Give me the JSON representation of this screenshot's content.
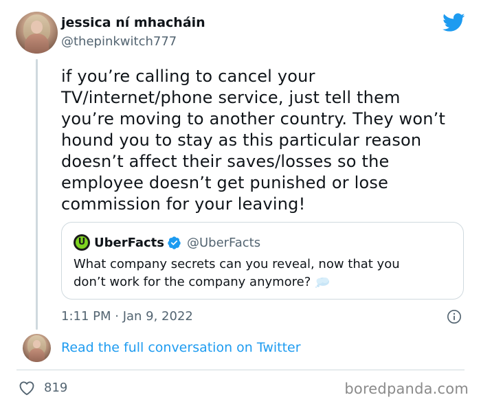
{
  "author": {
    "display_name": "jessica ní mhacháin",
    "handle": "@thepinkwitch777",
    "avatar_icon": "profile-photo"
  },
  "brand": {
    "icon": "twitter-bird-icon",
    "color": "#1d9bf0"
  },
  "tweet": {
    "text_lines": [
      "if you’re calling to cancel your",
      "TV/internet/phone service, just tell them",
      "you’re moving to another country. They won’t",
      "hound you to stay as this particular reason",
      "doesn’t affect their saves/losses so the",
      "employee doesn’t get punished or lose",
      "commission for your leaving!"
    ],
    "timestamp": "1:11 PM · Jan 9, 2022"
  },
  "quoted_tweet": {
    "display_name": "UberFacts",
    "handle": "@UberFacts",
    "verified": true,
    "text_lines": [
      "What company secrets can you reveal, now that you",
      "don’t work for the company anymore?"
    ],
    "trailing_emoji": "thought-balloon-icon"
  },
  "footer": {
    "read_full_label": "Read the full conversation on Twitter",
    "likes": "819",
    "watermark": "boredpanda.com"
  },
  "colors": {
    "text_primary": "#0f1419",
    "text_secondary": "#536471",
    "link": "#1d9bf0",
    "border": "#cfd9de"
  }
}
